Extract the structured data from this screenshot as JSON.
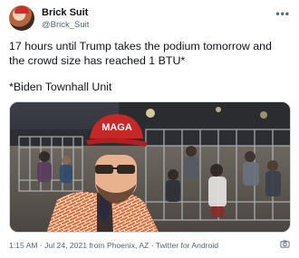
{
  "tweet": {
    "author_name": "Brick Suit",
    "author_handle": "@Brick_Suit",
    "more_icon": "more-horizontal-icon",
    "text_line1": "17 hours until Trump takes the podium tomorrow and",
    "text_line2": "the crowd size has reached 1 BTU*",
    "text_line3": "*Biden Townhall Unit",
    "hat_text": "MAGA",
    "meta_time": "1:15 AM",
    "meta_sep1": " · ",
    "meta_date": "Jul 24, 2021 from Phoenix, AZ",
    "meta_sep2": " · ",
    "meta_client": "Twitter for Android",
    "camera_icon": "camera-icon"
  }
}
